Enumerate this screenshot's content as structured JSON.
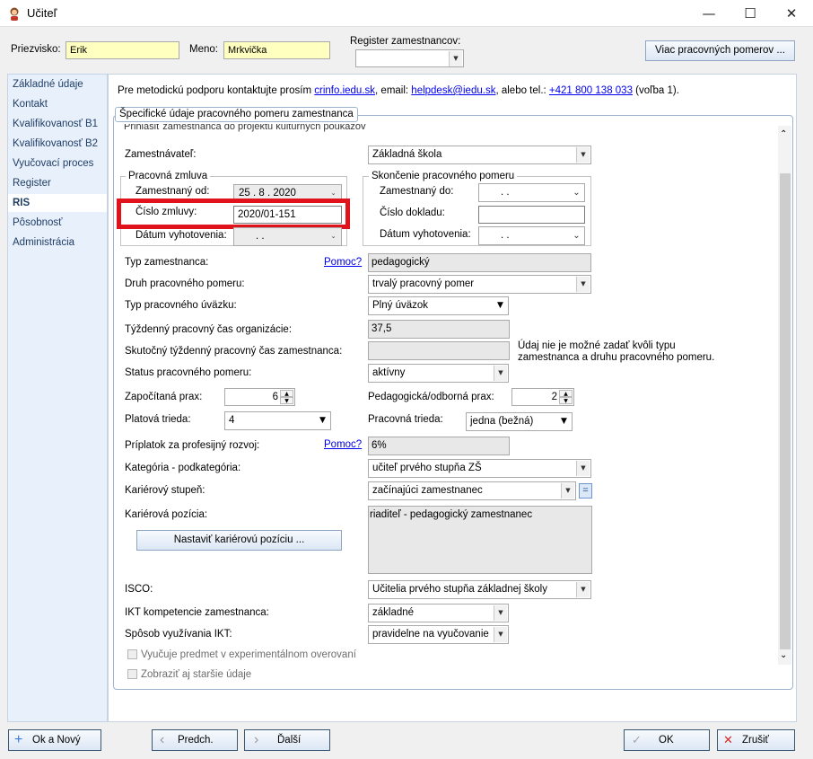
{
  "window": {
    "title": "Učiteľ",
    "minimize": "—",
    "maximize": "☐",
    "close": "✕"
  },
  "header": {
    "priezvisko_label": "Priezvisko:",
    "priezvisko_value": "Erik",
    "meno_label": "Meno:",
    "meno_value": "Mrkvička",
    "register_label": "Register zamestnancov:",
    "register_value": "",
    "viac_button": "Viac pracovných pomerov ..."
  },
  "sidebar": {
    "items": [
      {
        "label": "Základné údaje"
      },
      {
        "label": "Kontakt"
      },
      {
        "label": "Kvalifikovanosť B1"
      },
      {
        "label": "Kvalifikovanosť B2"
      },
      {
        "label": "Vyučovací proces"
      },
      {
        "label": "Register"
      },
      {
        "label": "RIS"
      },
      {
        "label": "Pôsobnosť"
      },
      {
        "label": "Administrácia"
      }
    ],
    "active_index": 6
  },
  "info": {
    "prefix": "Pre metodickú podporu kontaktujte prosím ",
    "link1": "crinfo.iedu.sk",
    "mid1": ", email: ",
    "link2": "helpdesk@iedu.sk",
    "mid2": ", alebo tel.: ",
    "link3": "+421 800 138 033",
    "suffix": " (voľba 1)."
  },
  "panel": {
    "title": "Špecifické údaje pracovného pomeru zamestnanca",
    "cut_checkbox_label": "Prihlásiť zamestnanca do projektu kultúrnych poukazov",
    "zamestnavatel_label": "Zamestnávateľ:",
    "zamestnavatel_value": "Základná škola",
    "pracovna_zmluva": {
      "legend": "Pracovná zmluva",
      "zamestnany_od_label": "Zamestnaný od:",
      "zamestnany_od_value": "25 .   8 .  2020",
      "cislo_zmluvy_label": "Číslo zmluvy:",
      "cislo_zmluvy_value": "2020/01-151",
      "datum_label": "Dátum vyhotovenia:",
      "datum_value": ".        ."
    },
    "skoncenie": {
      "legend": "Skončenie pracovného pomeru",
      "zamestnany_do_label": "Zamestnaný do:",
      "zamestnany_do_value": ".        .",
      "cislo_dokladu_label": "Číslo dokladu:",
      "cislo_dokladu_value": "",
      "datum_label": "Dátum vyhotovenia:",
      "datum_value": ".        ."
    },
    "typ_zamestnanca_label": "Typ zamestnanca:",
    "typ_zamestnanca_value": "pedagogický",
    "pomoc1": "Pomoc?",
    "druh_label": "Druh pracovného pomeru:",
    "druh_value": "trvalý pracovný pomer",
    "uvazok_label": "Typ pracovného úväzku:",
    "uvazok_value": "Plný úväzok",
    "tyzdenny_label": "Týždenný pracovný čas organizácie:",
    "tyzdenny_value": "37,5",
    "skutocny_label": "Skutočný týždenný pracovný čas zamestnanca:",
    "skutocny_value": "",
    "skutocny_note_line1": "Údaj nie je možné zadať kvôli typu",
    "skutocny_note_line2": "zamestnanca a druhu pracovného pomeru.",
    "status_label": "Status pracovného pomeru:",
    "status_value": "aktívny",
    "prax_label": "Započítaná prax:",
    "prax_value": "6",
    "ped_prax_label": "Pedagogická/odborná prax:",
    "ped_prax_value": "2",
    "platova_label": "Platová trieda:",
    "platova_value": "4",
    "pracovna_trieda_label": "Pracovná trieda:",
    "pracovna_trieda_value": "jedna (bežná)",
    "priplatok_label": "Príplatok za profesijný rozvoj:",
    "priplatok_value": "6%",
    "pomoc2": "Pomoc?",
    "kategoria_label": "Kategória - podkategória:",
    "kategoria_value": "učiteľ prvého stupňa ZŠ",
    "karierovy_label": "Kariérový stupeň:",
    "karierovy_value": "začínajúci zamestnanec",
    "equals_btn": "=",
    "pozicia_label": "Kariérová pozícia:",
    "pozicia_value": "riaditeľ - pedagogický zamestnanec",
    "nastavit_button": "Nastaviť kariérovú pozíciu ...",
    "isco_label": "ISCO:",
    "isco_value": "Učitelia prvého stupňa základnej školy",
    "ikt_label": "IKT kompetencie zamestnanca:",
    "ikt_value": "základné",
    "sposob_label": "Spôsob využívania IKT:",
    "sposob_value": "pravidelne na vyučovanie",
    "experiment_label": "Vyučuje predmet v experimentálnom overovaní",
    "starsie_label": "Zobraziť aj staršie údaje"
  },
  "footer": {
    "ok_novy": "Ok a Nový",
    "predch": "Predch.",
    "dalsi": "Ďalší",
    "ok": "OK",
    "zrusit": "Zrušiť"
  },
  "colors": {
    "highlight_red": "#e0121b",
    "yellow_field": "#ffffc0",
    "link": "#0000ee"
  }
}
